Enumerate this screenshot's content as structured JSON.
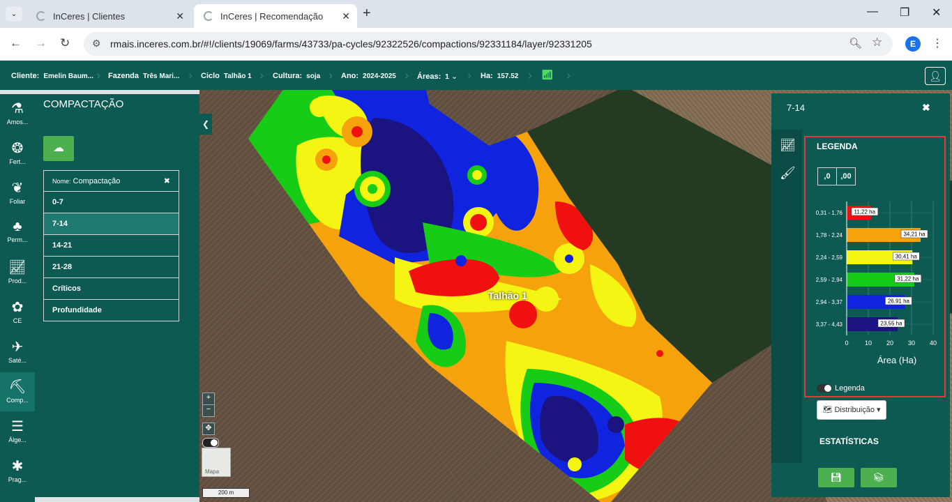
{
  "browser": {
    "tabs": [
      {
        "label": "InCeres | Clientes",
        "active": false
      },
      {
        "label": "InCeres | Recomendação",
        "active": true
      }
    ],
    "url": "rmais.inceres.com.br/#!/clients/19069/farms/43733/pa-cycles/92322526/compactions/92331184/layer/92331205",
    "profile_initial": "E"
  },
  "header": {
    "cliente_label": "Cliente:",
    "cliente_value": "Emelin Baum...",
    "fazenda_label": "Fazenda",
    "fazenda_value": "Três Mari...",
    "ciclo_label": "Ciclo",
    "ciclo_value": "Talhão 1",
    "cultura_label": "Cultura:",
    "cultura_value": "soja",
    "ano_label": "Ano:",
    "ano_value": "2024-2025",
    "areas_label": "Áreas:",
    "areas_value": "1",
    "ha_label": "Ha:",
    "ha_value": "157.52"
  },
  "rail": [
    {
      "label": "Amos...",
      "icon": "sample-icon"
    },
    {
      "label": "Fert...",
      "icon": "fertilizer-icon"
    },
    {
      "label": "Foliar",
      "icon": "leaf-icon"
    },
    {
      "label": "Perm...",
      "icon": "permanent-crop-icon"
    },
    {
      "label": "Prod...",
      "icon": "productivity-icon"
    },
    {
      "label": "CE",
      "icon": "plant-icon"
    },
    {
      "label": "Saté...",
      "icon": "satellite-icon"
    },
    {
      "label": "Comp...",
      "icon": "compaction-icon"
    },
    {
      "label": "Álge...",
      "icon": "layers-icon"
    },
    {
      "label": "Prag...",
      "icon": "bug-icon"
    }
  ],
  "left_panel": {
    "title": "COMPACTAÇÃO",
    "name_label": "Nome:",
    "name_value": "Compactação",
    "layers": [
      "0-7",
      "7-14",
      "14-21",
      "21-28",
      "Críticos",
      "Profundidade"
    ],
    "selected_layer": "7-14"
  },
  "map": {
    "field_label": "Talhão 1",
    "scale_label": "200 m",
    "thumb_label": "Mapa"
  },
  "right_panel": {
    "title": "7-14",
    "legend_title": "LEGENDA",
    "dec_less": ",0",
    "dec_more": ",00",
    "legend_toggle_label": "Legenda",
    "dist_button": "Distribuição",
    "stats_title": "ESTATÍSTICAS"
  },
  "chart_data": {
    "type": "bar",
    "orientation": "horizontal",
    "categories": [
      "0,31 - 1,76",
      "1,78 - 2,24",
      "2,24 - 2,59",
      "2,59 - 2,94",
      "2,94 - 3,37",
      "3,37 - 4,43"
    ],
    "values": [
      11.22,
      34.21,
      30.41,
      31.22,
      26.91,
      23.55
    ],
    "labels": [
      "11,22 ha",
      "34,21 ha",
      "30,41 ha",
      "31,22 ha",
      "26,91 ha",
      "23,55 ha"
    ],
    "colors": [
      "#f01010",
      "#f5a20c",
      "#f5f514",
      "#16cc16",
      "#1024e0",
      "#1a1380"
    ],
    "xlabel": "Área (Ha)",
    "xticks": [
      0,
      10,
      20,
      30,
      40
    ],
    "xlim": [
      0,
      40
    ],
    "grid": true
  }
}
